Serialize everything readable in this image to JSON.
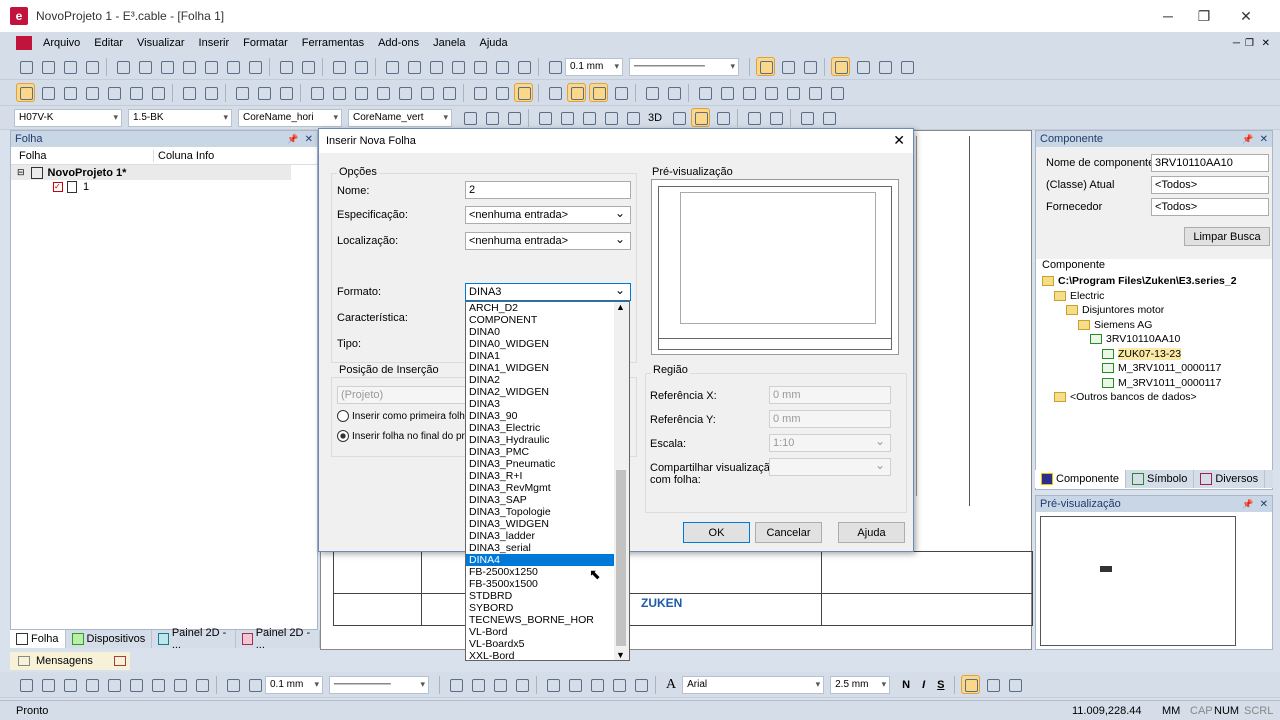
{
  "window": {
    "title": "NovoProjeto 1 - E³.cable - [Folha 1]",
    "min_icon": "minimize-icon",
    "max_icon": "restore-icon",
    "close_icon": "close-icon"
  },
  "menu": [
    "Arquivo",
    "Editar",
    "Visualizar",
    "Inserir",
    "Formatar",
    "Ferramentas",
    "Add-ons",
    "Janela",
    "Ajuda"
  ],
  "toolbar1": {
    "line_width": "0.1 mm"
  },
  "toolbar3": {
    "combo1": "H07V-K",
    "combo2": "1.5-BK",
    "combo3": "CoreName_hori",
    "combo4": "CoreName_vert",
    "view3d": "3D"
  },
  "left_panel": {
    "title": "Folha",
    "col1": "Folha",
    "col2": "Coluna Info",
    "project": "NovoProjeto 1*",
    "sheet": "1",
    "tabs": [
      "Folha",
      "Dispositivos",
      "Painel 2D - ...",
      "Painel 2D - ..."
    ]
  },
  "messages_tab": "Mensagens",
  "dialog": {
    "title": "Inserir Nova Folha",
    "options_group": "Opções",
    "name_label": "Nome:",
    "name_value": "2",
    "spec_label": "Especificação:",
    "spec_value": "<nenhuma entrada>",
    "loc_label": "Localização:",
    "loc_value": "<nenhuma entrada>",
    "format_label": "Formato:",
    "format_value": "DINA3",
    "char_label": "Característica:",
    "type_label": "Tipo:",
    "insert_pos_group": "Posição de Inserção",
    "insert_pos_value": "(Projeto)",
    "radio1": "Inserir como primeira folha",
    "radio2": "Inserir folha no final do pro",
    "preview_label": "Pré-visualização",
    "region_group": "Região",
    "refx_label": "Referência X:",
    "refx_value": "0 mm",
    "refy_label": "Referência Y:",
    "refy_value": "0 mm",
    "scale_label": "Escala:",
    "scale_value": "1:10",
    "share_label1": "Compartilhar visualização",
    "share_label2": "com folha:",
    "ok": "OK",
    "cancel": "Cancelar",
    "help": "Ajuda",
    "format_options": [
      "ARCH_D2",
      "COMPONENT",
      "DINA0",
      "DINA0_WIDGEN",
      "DINA1",
      "DINA1_WIDGEN",
      "DINA2",
      "DINA2_WIDGEN",
      "DINA3",
      "DINA3_90",
      "DINA3_Electric",
      "DINA3_Hydraulic",
      "DINA3_PMC",
      "DINA3_Pneumatic",
      "DINA3_R+I",
      "DINA3_RevMgmt",
      "DINA3_SAP",
      "DINA3_Topologie",
      "DINA3_WIDGEN",
      "DINA3_ladder",
      "DINA3_serial",
      "DINA4",
      "FB-2500x1250",
      "FB-3500x1500",
      "STDBRD",
      "SYBORD",
      "TECNEWS_BORNE_HOR",
      "VL-Bord",
      "VL-Boardx5",
      "XXL-Bord"
    ],
    "format_selected_index": 21
  },
  "canvas": {
    "logo_text": "ZUKEN"
  },
  "right_panel": {
    "title": "Componente",
    "comp_name_label": "Nome de componente",
    "comp_name_value": "3RV10110AA10",
    "class_label": "(Classe) Atual",
    "class_value": "<Todos>",
    "supplier_label": "Fornecedor",
    "supplier_value": "<Todos>",
    "clear_btn": "Limpar Busca",
    "tree_title": "Componente",
    "tree": [
      {
        "label": "C:\\Program Files\\Zuken\\E3.series_2",
        "level": 0,
        "bold": true
      },
      {
        "label": "Electric",
        "level": 1
      },
      {
        "label": "Disjuntores motor",
        "level": 2
      },
      {
        "label": "Siemens AG",
        "level": 3
      },
      {
        "label": "3RV10110AA10",
        "level": 4
      },
      {
        "label": "ZUK07-13-23",
        "level": 5,
        "selected": true
      },
      {
        "label": "M_3RV1011_0000117",
        "level": 5
      },
      {
        "label": "M_3RV1011_0000117",
        "level": 5
      },
      {
        "label": "<Outros bancos de dados>",
        "level": 1
      }
    ],
    "tabs": [
      "Componente",
      "Símbolo",
      "Diversos"
    ],
    "preview_title": "Pré-visualização"
  },
  "bottom_toolbar": {
    "line_width": "0.1 mm",
    "font": "Arial",
    "font_size": "2.5 mm",
    "bold": "N",
    "italic": "I",
    "underline": "S"
  },
  "status": {
    "left": "Pronto",
    "coords": "11.009,228.44",
    "mm": "MM",
    "cap": "CAP",
    "num": "NUM",
    "scrl": "SCRL"
  }
}
